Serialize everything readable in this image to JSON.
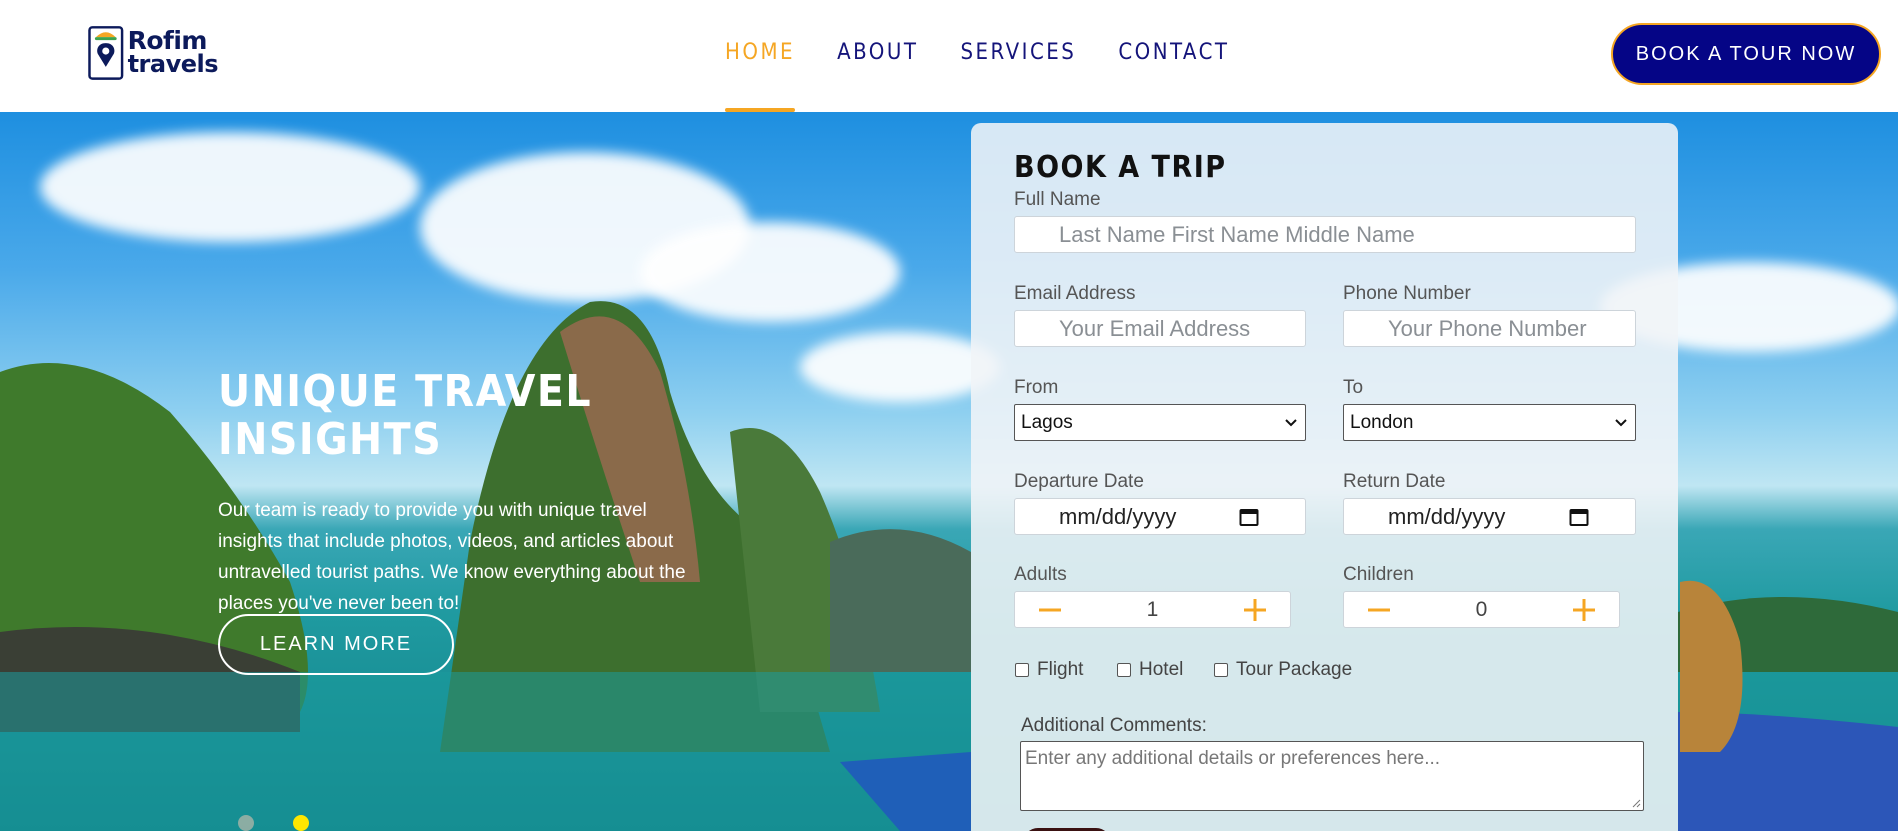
{
  "brand": {
    "line1": "Rofim",
    "line2": "travels"
  },
  "nav": {
    "items": [
      {
        "label": "HOME",
        "active": true
      },
      {
        "label": "ABOUT"
      },
      {
        "label": "SERVICES"
      },
      {
        "label": "CONTACT"
      }
    ],
    "cta_label": "BOOK A TOUR NOW"
  },
  "hero": {
    "title": "UNIQUE TRAVEL INSIGHTS",
    "text": "Our team is ready to provide you with unique travel insights that include photos, videos, and articles about untravelled tourist paths. We know everything about the places you've never been to!",
    "button_label": "LEARN MORE",
    "slides": 2,
    "active_slide": 2
  },
  "form": {
    "title": "BOOK A TRIP",
    "full_name_label": "Full Name",
    "full_name_placeholder": "Last Name  First Name  Middle Name",
    "email_label": "Email Address",
    "email_placeholder": "Your Email Address",
    "phone_label": "Phone Number",
    "phone_placeholder": "Your Phone Number",
    "from_label": "From",
    "from_value": "Lagos",
    "to_label": "To",
    "to_value": "London",
    "departure_label": "Departure Date",
    "departure_value": "mm/dd/yyyy",
    "return_label": "Return Date",
    "return_value": "mm/dd/yyyy",
    "adults_label": "Adults",
    "adults_value": "1",
    "children_label": "Children",
    "children_value": "0",
    "checkboxes": [
      "Flight",
      "Hotel",
      "Tour Package"
    ],
    "comments_label": "Additional Comments:",
    "comments_placeholder": "Enter any additional details or preferences here..."
  },
  "colors": {
    "navy": "#050586",
    "nav_text": "#14147a",
    "accent": "#f5a623",
    "active_dot": "#ffe600"
  },
  "icons": [
    "pin-logo-icon",
    "calendar-icon",
    "minus-icon",
    "plus-icon",
    "chevron-down-icon"
  ]
}
